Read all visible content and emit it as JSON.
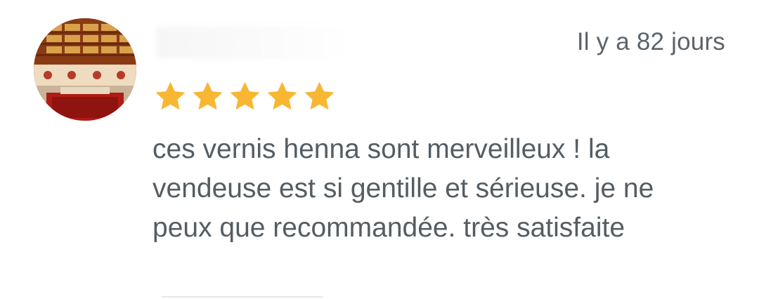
{
  "review": {
    "timestamp": "Il y a 82 jours",
    "rating": 5,
    "rating_max": 5,
    "text": "ces vernis henna sont merveilleux ! la vendeuse est si gentille et sérieuse. je ne peux que recommandée. très satisfaite"
  },
  "colors": {
    "star": "#f7b733",
    "text": "#555d63",
    "timestamp": "#5c646b"
  },
  "icons": {
    "star": "star-icon",
    "avatar": "bookshelf-room-photo"
  }
}
